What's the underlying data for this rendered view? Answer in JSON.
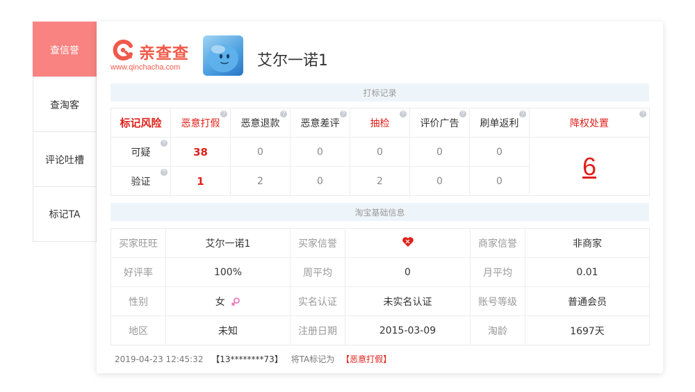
{
  "sidebar": {
    "items": [
      {
        "label": "查信誉"
      },
      {
        "label": "查淘客"
      },
      {
        "label": "评论吐槽"
      },
      {
        "label": "标记TA"
      }
    ]
  },
  "header": {
    "logo_text": "亲查查",
    "logo_url": "www.qinchacha.com",
    "shop_name": "艾尔一诺1"
  },
  "mark_section": {
    "title": "打标记录",
    "headers": [
      "标记风险",
      "恶意打假",
      "恶意退款",
      "恶意差评",
      "抽检",
      "评价广告",
      "刷单返利",
      "降权处置"
    ],
    "rows": [
      {
        "label": "可疑",
        "values": [
          "38",
          "0",
          "0",
          "0",
          "0",
          "0"
        ]
      },
      {
        "label": "验证",
        "values": [
          "1",
          "2",
          "0",
          "2",
          "0",
          "0"
        ]
      }
    ],
    "demotion_count": "6"
  },
  "info_section": {
    "title": "淘宝基础信息",
    "rows": [
      [
        {
          "label": "买家旺旺",
          "value": "艾尔一诺1"
        },
        {
          "label": "买家信誉",
          "value": ""
        },
        {
          "label": "商家信誉",
          "value": "非商家"
        }
      ],
      [
        {
          "label": "好评率",
          "value": "100%"
        },
        {
          "label": "周平均",
          "value": "0"
        },
        {
          "label": "月平均",
          "value": "0.01"
        }
      ],
      [
        {
          "label": "性别",
          "value": "女"
        },
        {
          "label": "实名认证",
          "value": "未实名认证"
        },
        {
          "label": "账号等级",
          "value": "普通会员"
        }
      ],
      [
        {
          "label": "地区",
          "value": "未知"
        },
        {
          "label": "注册日期",
          "value": "2015-03-09"
        },
        {
          "label": "淘龄",
          "value": "1697天"
        }
      ]
    ]
  },
  "footer": {
    "timestamp": "2019-04-23 12:45:32",
    "account": "【13********73】",
    "action": "将TA标记为",
    "tag": "【恶意打假】"
  },
  "colors": {
    "accent": "#f88381",
    "alert": "#e0201a",
    "brand": "#f05a4a",
    "section_bg": "#eef5fa"
  },
  "icons": [
    "help-icon",
    "heart-rank-icon",
    "female-icon",
    "qinchacha-logo-icon",
    "avatar-image"
  ]
}
